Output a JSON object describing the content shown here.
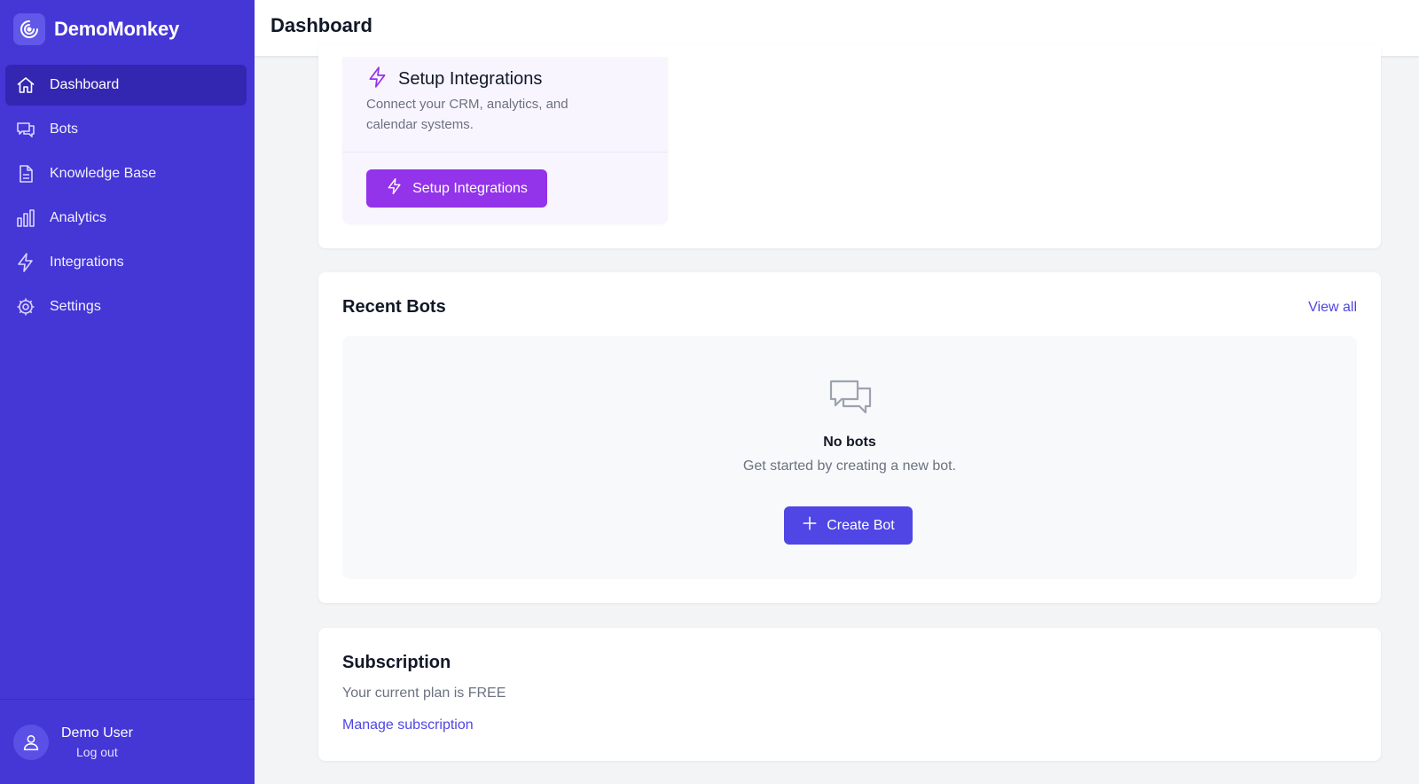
{
  "app": {
    "name": "DemoMonkey"
  },
  "sidebar": {
    "items": [
      {
        "label": "Dashboard",
        "icon": "home-icon",
        "active": true
      },
      {
        "label": "Bots",
        "icon": "chat-icon",
        "active": false
      },
      {
        "label": "Knowledge Base",
        "icon": "document-icon",
        "active": false
      },
      {
        "label": "Analytics",
        "icon": "bar-chart-icon",
        "active": false
      },
      {
        "label": "Integrations",
        "icon": "bolt-icon",
        "active": false
      },
      {
        "label": "Settings",
        "icon": "gear-icon",
        "active": false
      }
    ],
    "user": {
      "name": "Demo User",
      "logout_label": "Log out"
    }
  },
  "header": {
    "title": "Dashboard"
  },
  "integrations_card": {
    "title": "Setup Integrations",
    "description": "Connect your CRM, analytics, and calendar systems.",
    "button_label": "Setup Integrations"
  },
  "recent_bots": {
    "title": "Recent Bots",
    "view_all_label": "View all",
    "empty_title": "No bots",
    "empty_description": "Get started by creating a new bot.",
    "create_button_label": "Create Bot"
  },
  "subscription": {
    "title": "Subscription",
    "plan_text": "Your current plan is FREE",
    "manage_link_label": "Manage subscription"
  },
  "colors": {
    "sidebar_bg": "#4536d6",
    "sidebar_active": "#3326b0",
    "accent_indigo": "#4f46e5",
    "accent_purple": "#9333ea"
  }
}
